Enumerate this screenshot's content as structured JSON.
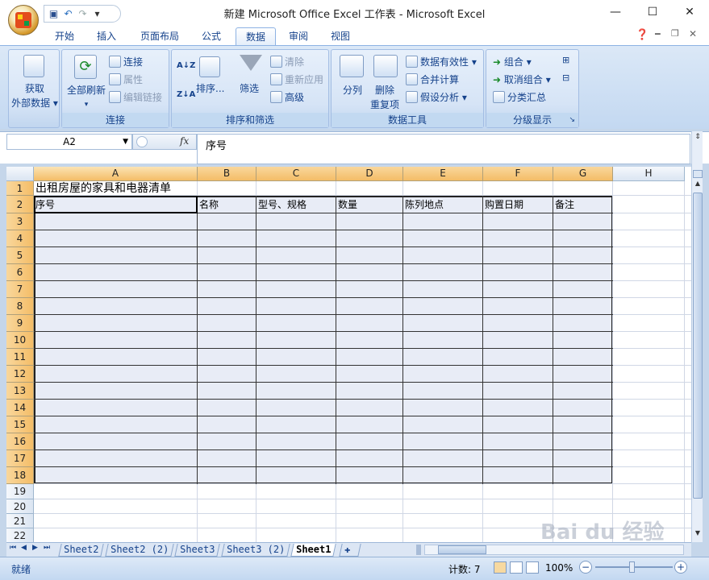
{
  "window": {
    "title": "新建 Microsoft Office Excel 工作表 - Microsoft Excel",
    "minimize": "—",
    "maximize": "☐",
    "close": "✕"
  },
  "qat": {
    "save_icon": "save-icon",
    "undo_icon": "undo-icon",
    "redo_icon": "redo-icon",
    "more": "▾"
  },
  "tabs": [
    {
      "label": "开始"
    },
    {
      "label": "插入"
    },
    {
      "label": "页面布局"
    },
    {
      "label": "公式"
    },
    {
      "label": "数据",
      "active": true
    },
    {
      "label": "审阅"
    },
    {
      "label": "视图"
    }
  ],
  "ribbon": {
    "get_external": {
      "line1": "获取",
      "line2": "外部数据 ▾"
    },
    "refresh_all": {
      "line1": "全部刷新",
      "line2": "▾"
    },
    "connections": "连接",
    "properties": "属性",
    "edit_links": "编辑链接",
    "group_connections": "连接",
    "sort_az": "A↓Z",
    "sort_za": "Z↓A",
    "sort": "排序...",
    "filter": "筛选",
    "clear": "清除",
    "reapply": "重新应用",
    "advanced": "高级",
    "group_sort_filter": "排序和筛选",
    "text_to_columns": "分列",
    "remove_duplicates": {
      "line1": "删除",
      "line2": "重复项"
    },
    "data_validation": "数据有效性 ▾",
    "consolidate": "合并计算",
    "what_if": "假设分析 ▾",
    "group_data_tools": "数据工具",
    "group": "组合 ▾",
    "ungroup": "取消组合 ▾",
    "subtotal": "分类汇总",
    "group_outline": "分级显示"
  },
  "formula_bar": {
    "name_box": "A2",
    "fx": "fx",
    "content": "序号"
  },
  "sheet": {
    "columns": [
      "A",
      "B",
      "C",
      "D",
      "E",
      "F",
      "G",
      "H"
    ],
    "rows": [
      "1",
      "2",
      "3",
      "4",
      "5",
      "6",
      "7",
      "8",
      "9",
      "10",
      "11",
      "12",
      "13",
      "14",
      "15",
      "16",
      "17",
      "18",
      "19",
      "20",
      "21",
      "22"
    ],
    "title": "出租房屋的家具和电器清单",
    "headers": [
      "序号",
      "名称",
      "型号、规格",
      "数量",
      "陈列地点",
      "购置日期",
      "备注"
    ]
  },
  "sheet_tabs": [
    {
      "label": "Sheet2"
    },
    {
      "label": "Sheet2 (2)"
    },
    {
      "label": "Sheet3"
    },
    {
      "label": "Sheet3 (2)"
    },
    {
      "label": "Sheet1",
      "active": true
    }
  ],
  "nav": {
    "first": "⏮",
    "prev": "◀",
    "next": "▶",
    "last": "⏭"
  },
  "status": {
    "ready": "就绪",
    "count": "计数: 7",
    "zoom": "100%"
  },
  "colors": {
    "accent": "#15428b",
    "header_selected": "#f4bd67",
    "table_fill": "#e8ecf6"
  }
}
